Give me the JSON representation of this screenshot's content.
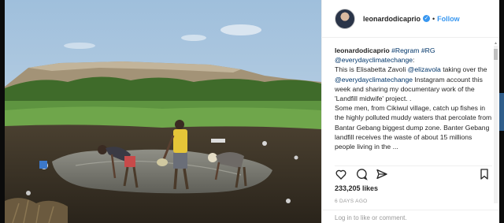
{
  "post": {
    "username": "leonardodicaprio",
    "verified_icon": "verified-badge-icon",
    "separator": "•",
    "follow_label": "Follow",
    "caption": {
      "username": "leonardodicaprio",
      "tags_line": "#Regram #RG",
      "mention_source": "@everydayclimatechange",
      "source_suffix": ":",
      "p1_a": "This is Elisabetta Zavoli ",
      "p1_mention": "@elizavola",
      "p1_b": " taking over the ",
      "p1_mention2": "@everydayclimatechange",
      "p1_c": " Instagram account this week and sharing my documentary work of the 'Landfill midwife' project. .",
      "p2": "Some men, from Cikiwul village, catch up fishes in the highly polluted muddy waters that percolate from Bantar Gebang biggest dump zone. Banter Gebang landfill receives the waste of about 15 millions people living in the ..."
    },
    "likes": "233,205 likes",
    "age": "6 DAYS AGO",
    "comment_placeholder": "Log in to like or comment."
  },
  "icons": {
    "like": "heart-icon",
    "comment": "comment-icon",
    "share": "share-icon",
    "save": "bookmark-icon"
  },
  "colors": {
    "accent": "#3897f0",
    "link": "#003569",
    "text": "#262626",
    "muted": "#999999"
  }
}
